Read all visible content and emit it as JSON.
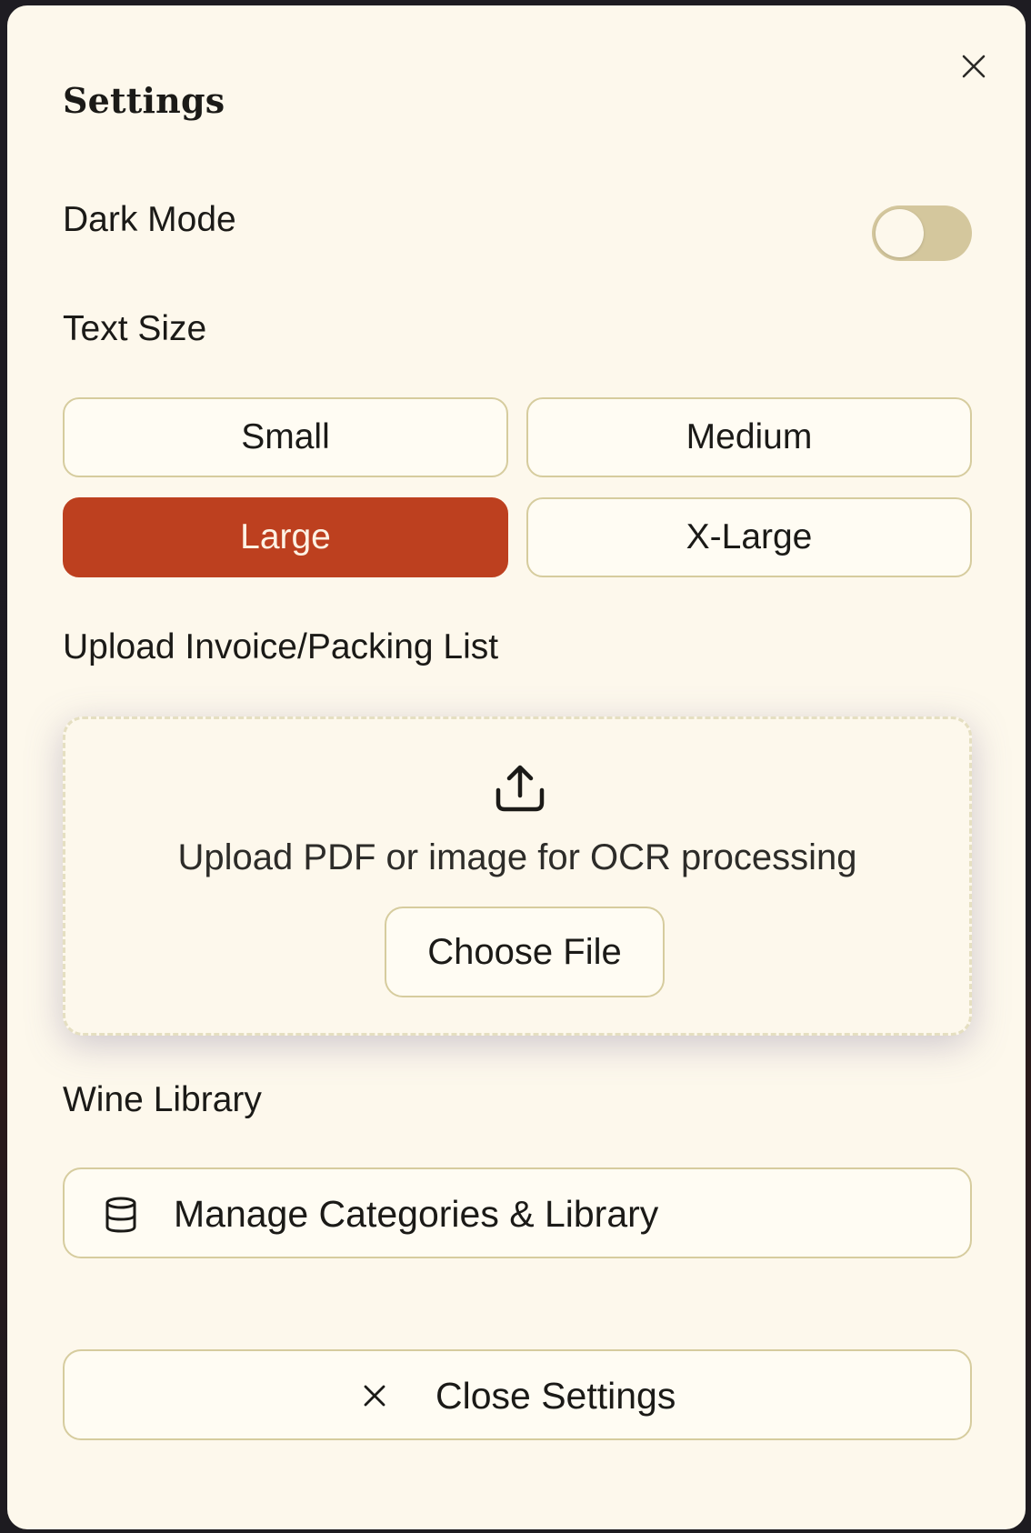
{
  "dialog": {
    "title": "Settings"
  },
  "dark_mode": {
    "label": "Dark Mode",
    "enabled": false
  },
  "text_size": {
    "label": "Text Size",
    "options": [
      "Small",
      "Medium",
      "Large",
      "X-Large"
    ],
    "selected": "Large"
  },
  "upload": {
    "label": "Upload Invoice/Packing List",
    "hint": "Upload PDF or image for OCR processing",
    "button_label": "Choose File",
    "icon": "upload-icon"
  },
  "library": {
    "label": "Wine Library",
    "button_label": "Manage Categories & Library",
    "icon": "database-icon"
  },
  "footer": {
    "close_label": "Close Settings",
    "icon": "close-icon"
  },
  "colors": {
    "background": "#fdf8ec",
    "accent": "#bd401f",
    "border": "#d6cc9e",
    "toggle_track": "#d4c79d"
  }
}
